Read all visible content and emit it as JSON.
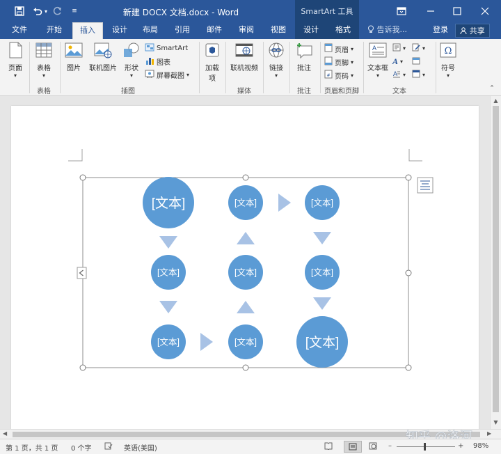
{
  "window": {
    "doc_title": "新建 DOCX 文档.docx - Word",
    "smartart_tools": "SmartArt 工具",
    "quick_access": [
      "save-icon",
      "undo-icon",
      "redo-icon",
      "customize-icon"
    ]
  },
  "tabs": [
    {
      "label": "文件"
    },
    {
      "label": "开始"
    },
    {
      "label": "插入",
      "active": true
    },
    {
      "label": "设计"
    },
    {
      "label": "布局"
    },
    {
      "label": "引用"
    },
    {
      "label": "邮件"
    },
    {
      "label": "审阅"
    },
    {
      "label": "视图"
    },
    {
      "label": "设计",
      "contextual": true
    },
    {
      "label": "格式",
      "contextual": true
    }
  ],
  "tell_me": "告诉我...",
  "sign_in": "登录",
  "share": "共享",
  "ribbon": {
    "pages": "页面",
    "table": "表格",
    "picture": "图片",
    "online_picture": "联机图片",
    "shapes": "形状",
    "smartart": "SmartArt",
    "chart": "图表",
    "screenshot": "屏幕截图",
    "addins_line1": "加载",
    "addins_line2": "项",
    "online_video": "联机视频",
    "link": "链接",
    "comment": "批注",
    "header": "页眉",
    "footer": "页脚",
    "page_number": "页码",
    "textbox": "文本框",
    "symbol": "符号",
    "groups": {
      "table": "表格",
      "illustrations": "插图",
      "media": "媒体",
      "comments": "批注",
      "header_footer": "页眉和页脚",
      "text": "文本"
    }
  },
  "smartart": {
    "placeholder": "[文本]",
    "node_color": "#5b9bd5",
    "arrow_color": "#a8c2e5"
  },
  "statusbar": {
    "page": "第 1 页，共 1 页",
    "words": "0 个字",
    "language": "英语(美国)",
    "zoom": "98%"
  },
  "watermark": "知乎 @洛河",
  "colors": {
    "title_bar": "#2b579a",
    "contextual_tab": "#1e4577",
    "ribbon_bg": "#f3f3f3"
  }
}
